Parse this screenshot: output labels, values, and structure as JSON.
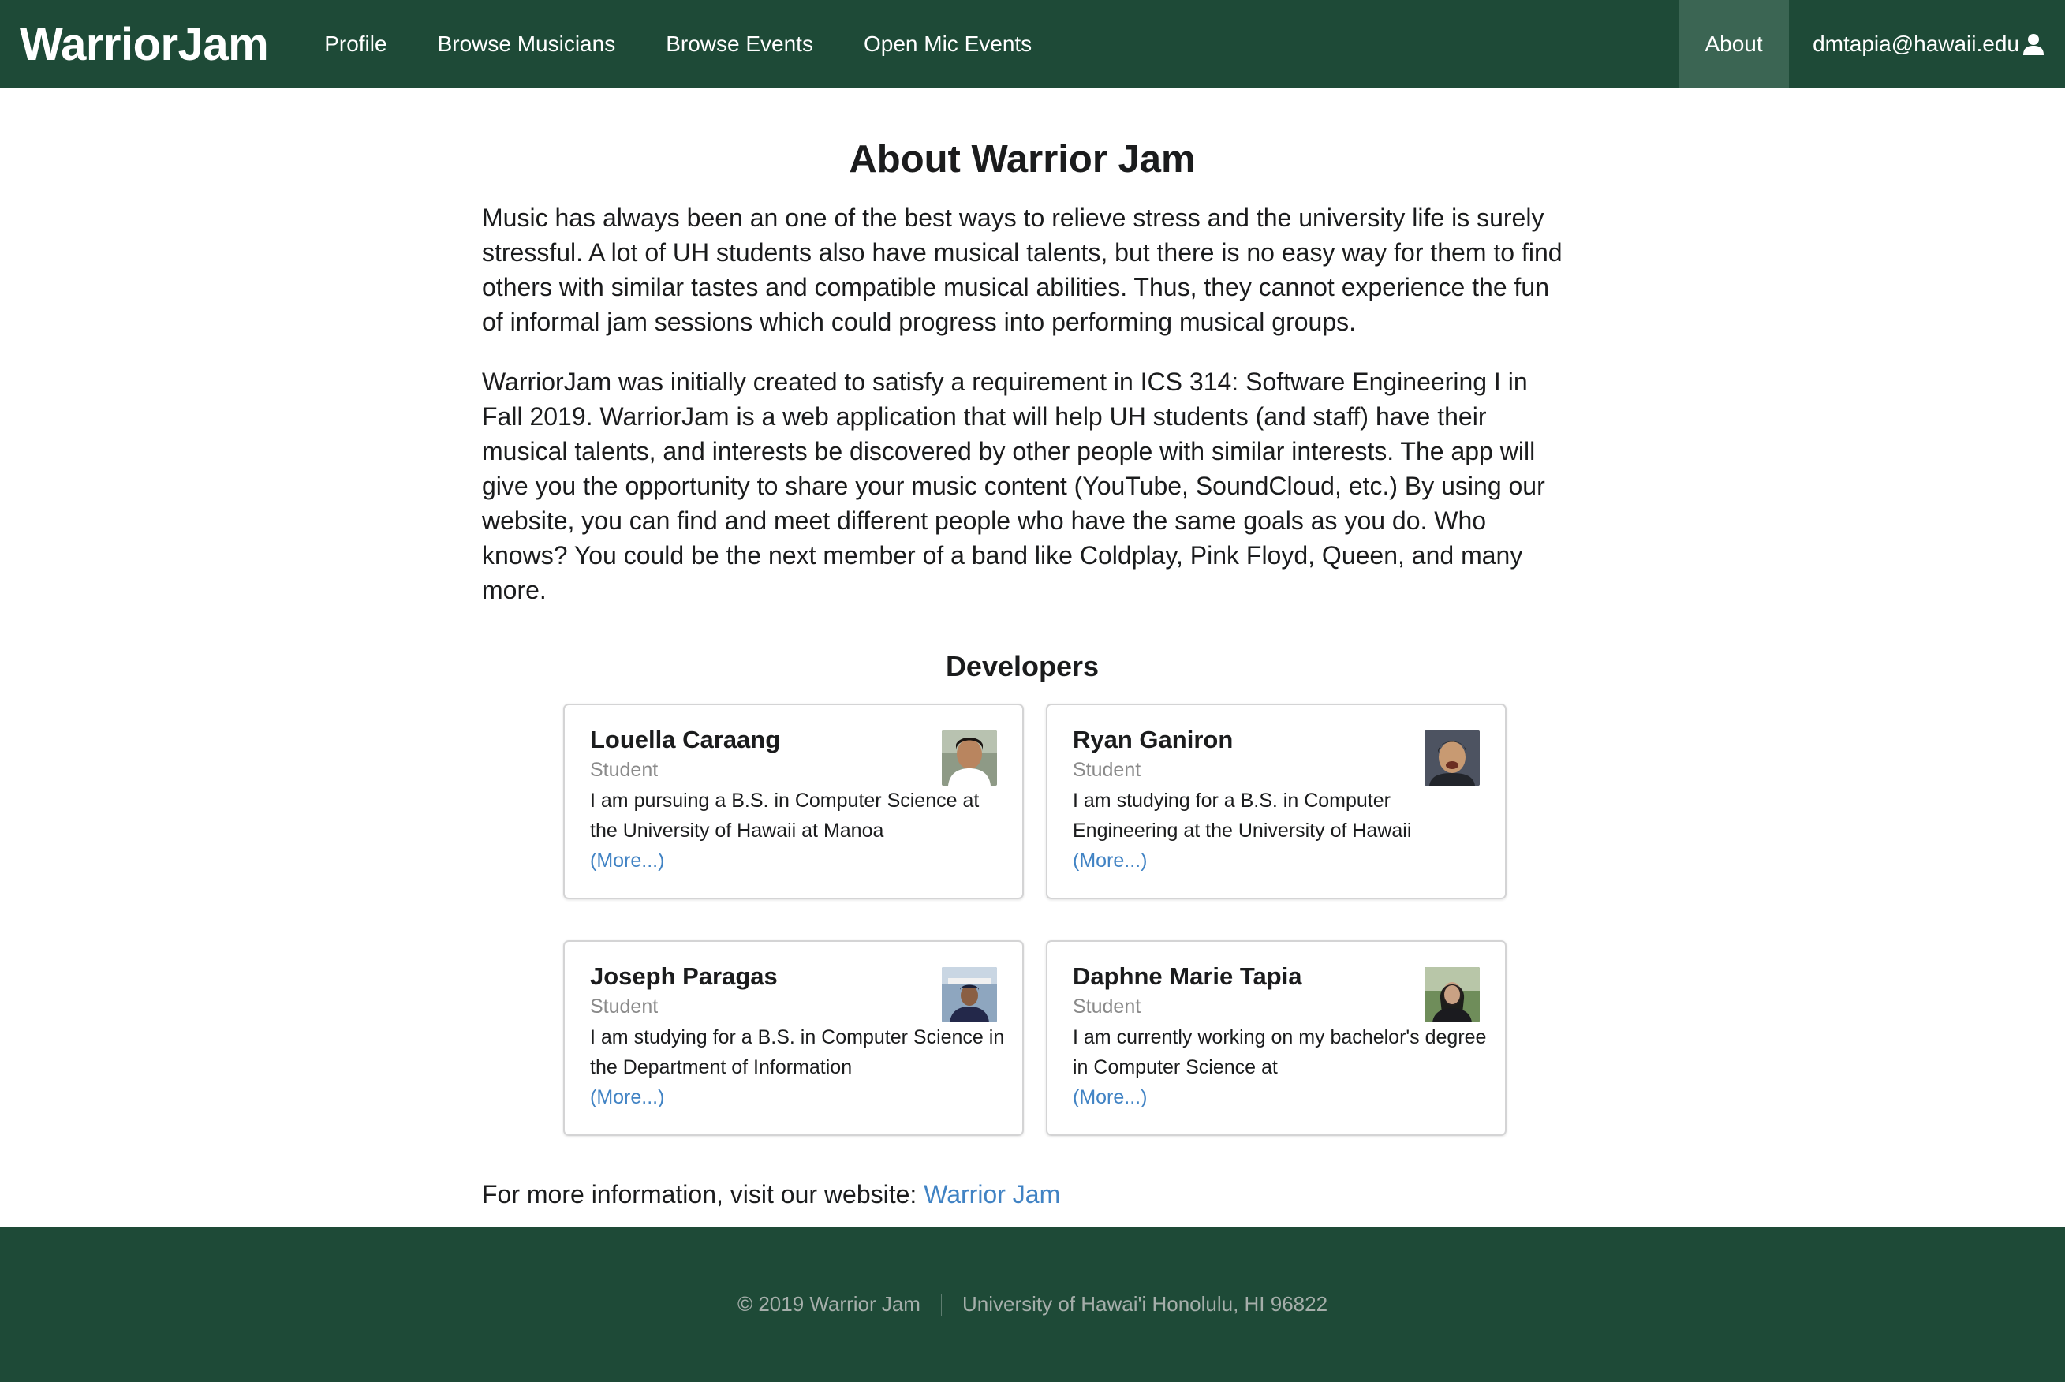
{
  "nav": {
    "brand": "WarriorJam",
    "items": [
      "Profile",
      "Browse Musicians",
      "Browse Events",
      "Open Mic Events"
    ],
    "active_item": "About",
    "user_email": "dmtapia@hawaii.edu",
    "user_icon": "user-icon"
  },
  "main": {
    "title": "About Warrior Jam",
    "paragraphs": [
      "Music has always been an one of the best ways to relieve stress and the university life is surely stressful. A lot of UH students also have musical talents, but there is no easy way for them to find others with similar tastes and compatible musical abilities. Thus, they cannot experience the fun of informal jam sessions which could progress into performing musical groups.",
      "WarriorJam was initially created to satisfy a requirement in ICS 314: Software Engineering I in Fall 2019. WarriorJam is a web application that will help UH students (and staff) have their musical talents, and interests be discovered by other people with similar interests. The app will give you the opportunity to share your music content (YouTube, SoundCloud, etc.) By using our website, you can find and meet different people who have the same goals as you do. Who knows? You could be the next member of a band like Coldplay, Pink Floyd, Queen, and many more."
    ],
    "developers_title": "Developers",
    "developers": [
      {
        "name": "Louella Caraang",
        "role": "Student",
        "description": "I am pursuing a B.S. in Computer Science at the University of Hawaii at Manoa",
        "more": "(More...)"
      },
      {
        "name": "Ryan Ganiron",
        "role": "Student",
        "description": "I am studying for a B.S. in Computer Engineering at the University of Hawaii",
        "more": "(More...)"
      },
      {
        "name": "Joseph Paragas",
        "role": "Student",
        "description": "I am studying for a B.S. in Computer Science in the Department of Information",
        "more": "(More...)"
      },
      {
        "name": "Daphne Marie Tapia",
        "role": "Student",
        "description": "I am currently working on my bachelor's degree in Computer Science at",
        "more": "(More...)"
      }
    ],
    "more_info_text": "For more information, visit our website: ",
    "more_info_link": "Warrior Jam"
  },
  "footer": {
    "copyright": "© 2019 Warrior Jam",
    "address": "University of Hawai'i Honolulu, HI 96822"
  },
  "colors": {
    "nav_bg": "#1e4a37",
    "nav_active_bg": "#3b6553",
    "link": "#4183c4"
  }
}
